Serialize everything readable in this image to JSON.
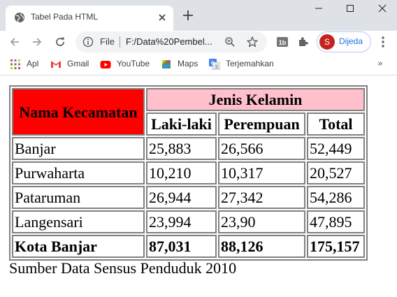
{
  "browser": {
    "tab": {
      "title": "Tabel Pada HTML",
      "favicon": "globe-icon"
    },
    "window_controls": [
      "minimize-icon",
      "maximize-icon",
      "close-icon"
    ],
    "omnibox": {
      "scheme": "File",
      "url": "F:/Data%20Pembel..."
    },
    "profile": {
      "initial": "S",
      "name": "Dijeda",
      "color": "#c5221f"
    },
    "bookmarks": [
      {
        "label": "Apl",
        "icon": "apps-grid-icon"
      },
      {
        "label": "Gmail",
        "icon": "gmail-icon"
      },
      {
        "label": "YouTube",
        "icon": "youtube-icon"
      },
      {
        "label": "Maps",
        "icon": "maps-icon"
      },
      {
        "label": "Terjemahkan",
        "icon": "translate-icon"
      }
    ],
    "bookmarks_overflow": "»"
  },
  "table": {
    "header": {
      "kecamatan": "Nama Kecamatan",
      "jenis_kelamin": "Jenis Kelamin",
      "laki": "Laki-laki",
      "perempuan": "Perempuan",
      "total": "Total"
    },
    "header_colors": {
      "kecamatan": "#ff0000",
      "jenis_kelamin": "#ffc0cb"
    },
    "rows": [
      {
        "name": "Banjar",
        "laki": "25,883",
        "perempuan": "26,566",
        "total": "52,449"
      },
      {
        "name": "Purwaharta",
        "laki": "10,210",
        "perempuan": "10,317",
        "total": "20,527"
      },
      {
        "name": "Pataruman",
        "laki": "26,944",
        "perempuan": "27,342",
        "total": "54,286"
      },
      {
        "name": "Langensari",
        "laki": "23,994",
        "perempuan": "23,90",
        "total": "47,895"
      }
    ],
    "total_row": {
      "name": "Kota Banjar",
      "laki": "87,031",
      "perempuan": "88,126",
      "total": "175,157"
    }
  },
  "caption": "Sumber Data Sensus Penduduk 2010"
}
